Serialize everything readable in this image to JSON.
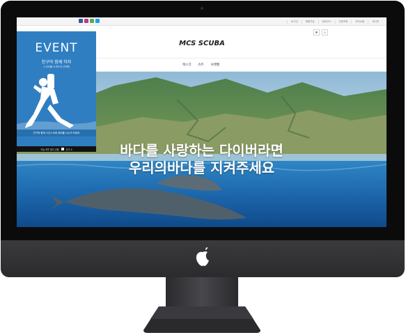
{
  "topbar": {
    "social_icons": [
      {
        "name": "facebook-icon",
        "color": "#3b5998"
      },
      {
        "name": "instagram-icon",
        "color": "#c13584"
      },
      {
        "name": "kakao-icon",
        "color": "#57a957"
      },
      {
        "name": "twitter-icon",
        "color": "#1da1f2"
      }
    ],
    "links": [
      "로그인",
      "회원가입",
      "장바구니",
      "주문조회",
      "마이쇼핑",
      "게시판"
    ]
  },
  "header": {
    "logo": "MCS SCUBA",
    "icons": [
      "bookmark-icon",
      "search-icon"
    ],
    "icon_glyphs": [
      "★",
      "⌕"
    ]
  },
  "nav": {
    "items": [
      "렉스크",
      "슈트",
      "보레벨"
    ]
  },
  "hero": {
    "line1": "바다를 사랑하는 다이버라면",
    "line2": "우리의바다를 지켜주세요"
  },
  "popup": {
    "title": "EVENT",
    "subtitle": "친구야 함께 하자",
    "subtitle_small": "스쿠버를 소개드리 선택해",
    "note": "친구와 함께 스킨스쿠버 취미를 나누어 보세요",
    "dont_show": "오늘 하루 열지 않음",
    "close": "닫기 X",
    "bg_color": "#2f7ec2"
  }
}
